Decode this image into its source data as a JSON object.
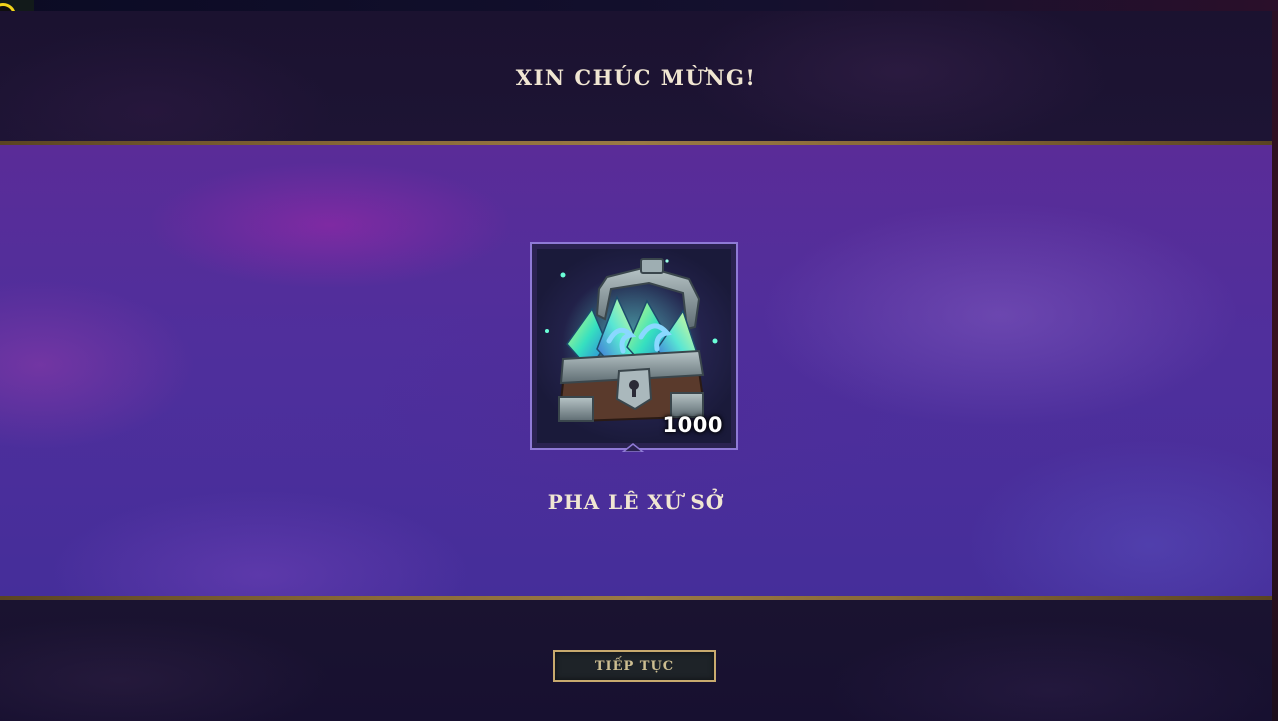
{
  "modal": {
    "title": "XIN CHÚC MỪNG!",
    "reward": {
      "name": "PHA LÊ XỨ SỞ",
      "count": "1000",
      "icon": "crystal-chest-icon"
    },
    "continue_label": "TIẾP TỤC"
  },
  "colors": {
    "title_text": "#f0e6d2",
    "gold_border": "#c8aa6e",
    "button_text": "#cdbe91",
    "button_bg": "#1e2328",
    "frame_border": "#8f7ad6",
    "reward_band_bg": "#4f2f9c",
    "header_bg": "#1b1230"
  }
}
